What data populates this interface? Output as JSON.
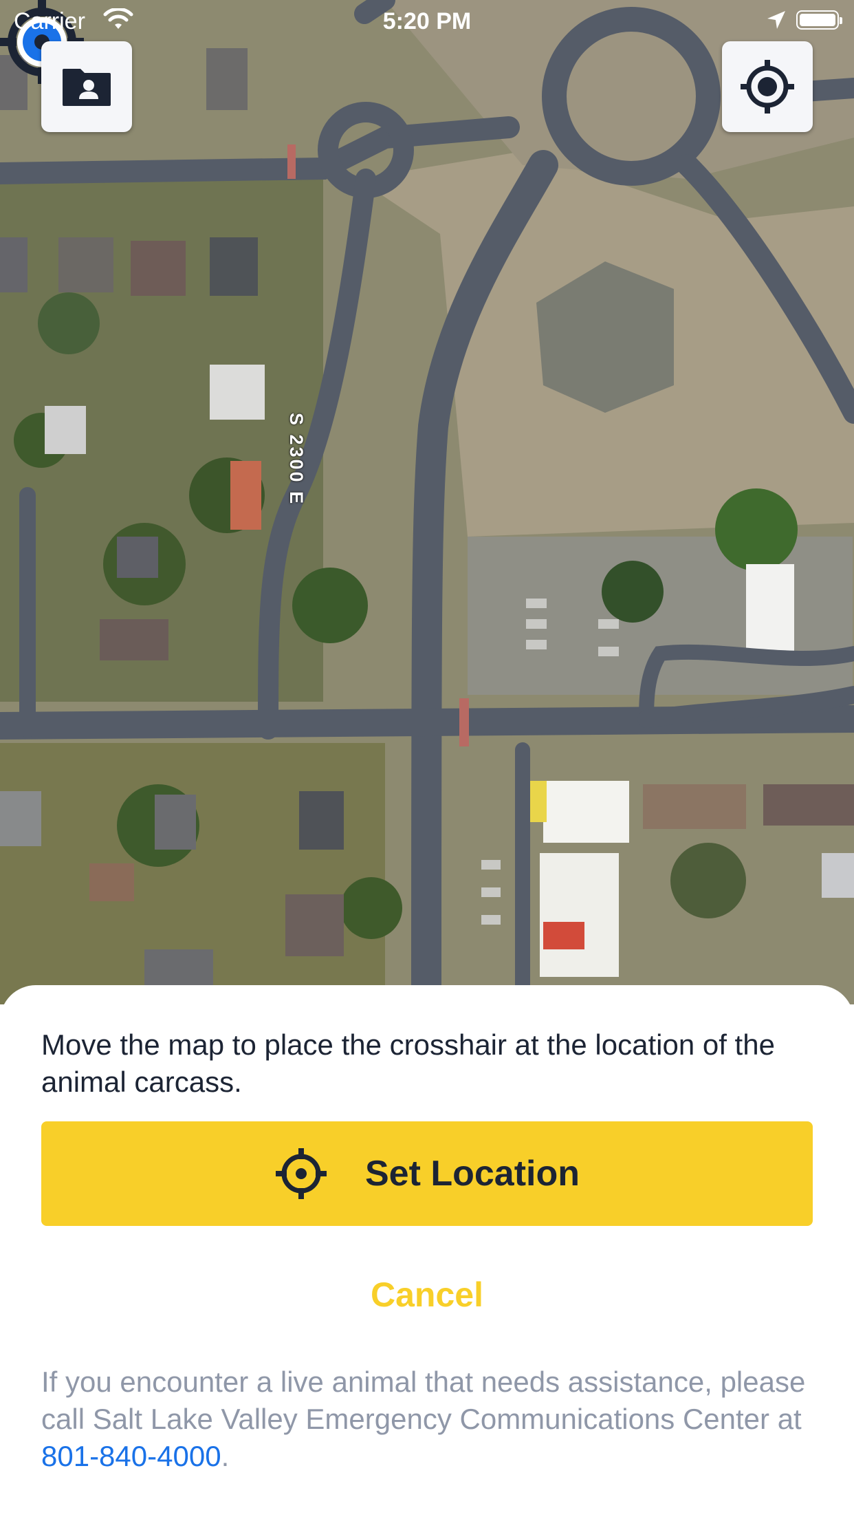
{
  "status_bar": {
    "carrier": "Carrier",
    "time": "5:20 PM",
    "wifi_icon": "wifi-icon",
    "location_icon": "location-arrow-icon",
    "battery_icon": "battery-icon"
  },
  "map": {
    "type": "satellite",
    "street_label": "S 2300 E",
    "folder_button_icon": "contact-folder-icon",
    "locate_button_icon": "current-location-icon",
    "crosshair_icon": "crosshair-icon",
    "crosshair_color": "#1a72e8"
  },
  "sheet": {
    "instruction": "Move the map to place the crosshair at the location of the animal carcass.",
    "set_location_label": "Set Location",
    "set_location_icon": "crosshair-icon",
    "cancel_label": "Cancel",
    "info_prefix": "If you encounter a live animal that needs assistance, please call Salt Lake Valley Emergency Communications Center at ",
    "phone": "801-840-4000",
    "info_suffix": "."
  },
  "colors": {
    "accent_yellow": "#f8cf29",
    "dark_navy": "#1c2434",
    "link_blue": "#1a72e8",
    "muted_text": "#8f97a8"
  }
}
